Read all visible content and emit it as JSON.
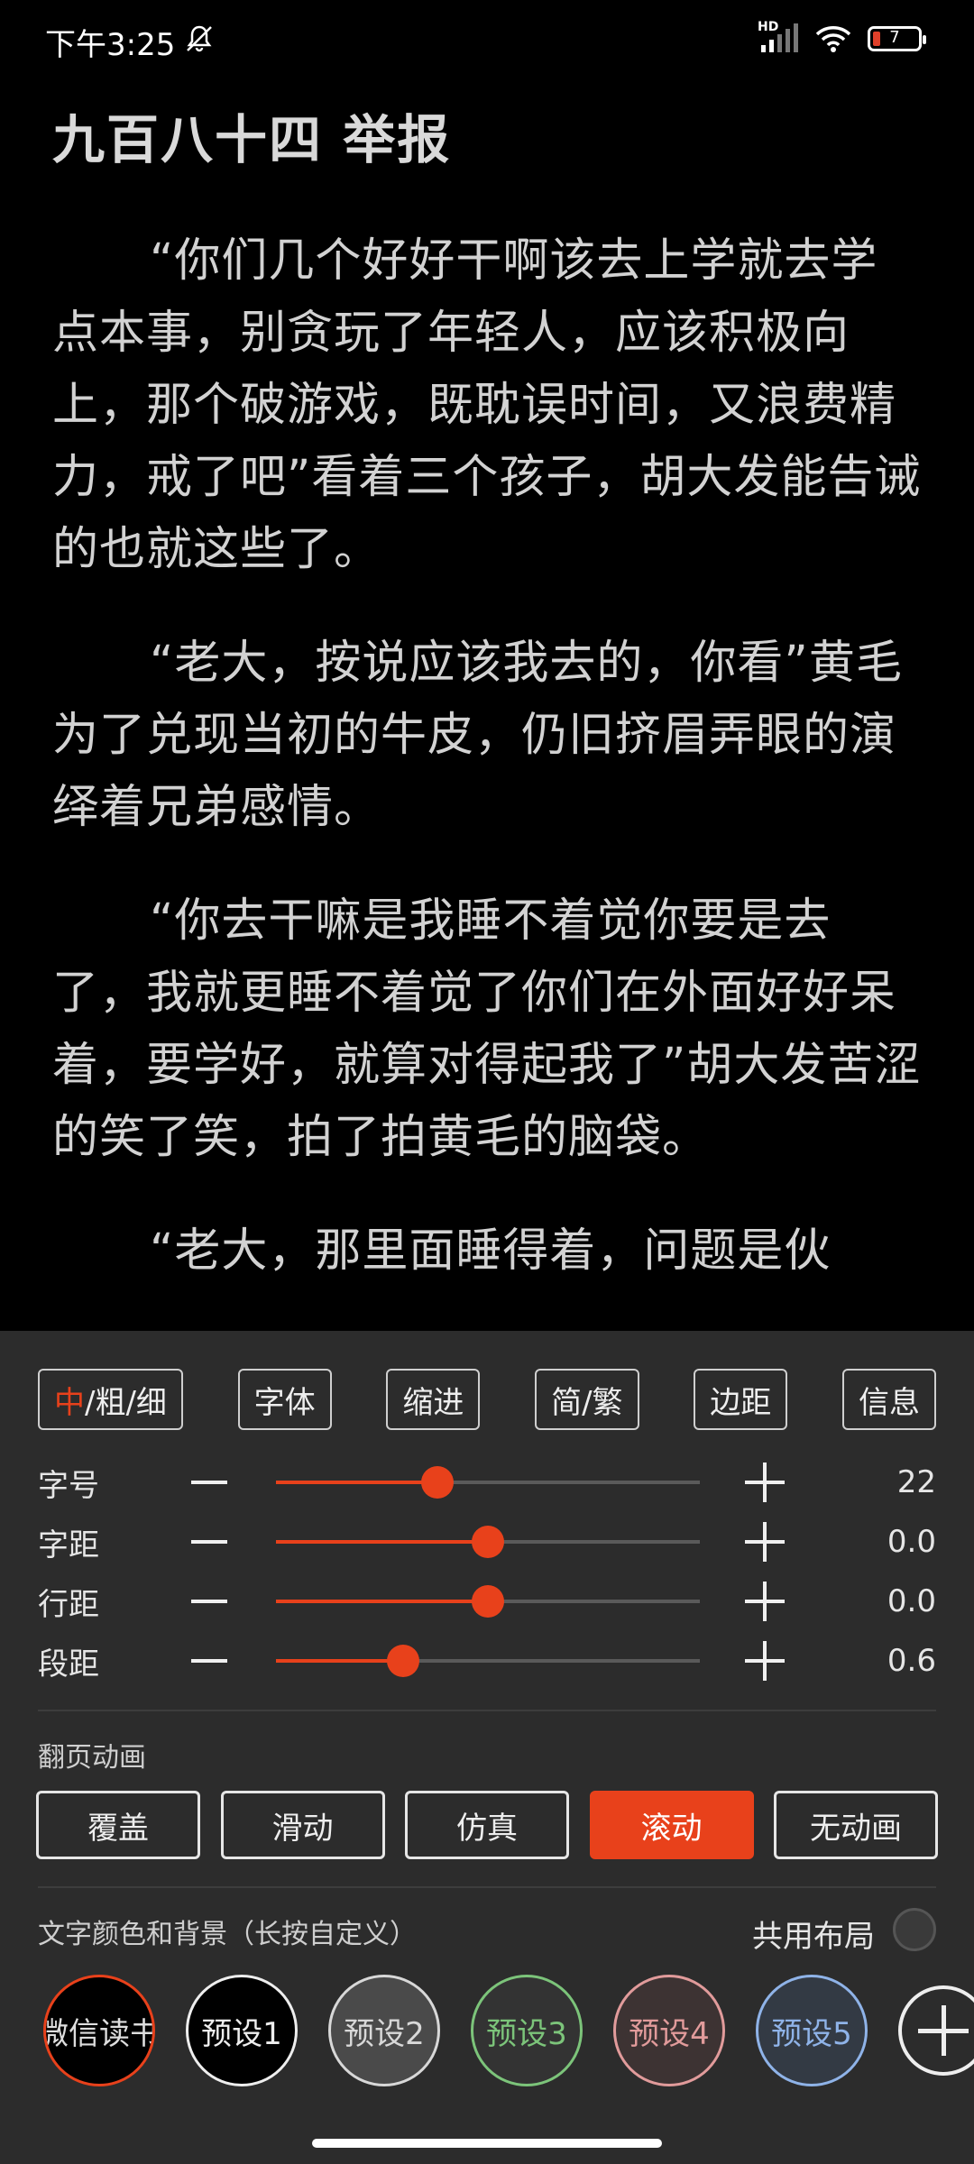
{
  "status_bar": {
    "time": "下午3:25",
    "hd": "HD",
    "battery_level": "7",
    "icons": [
      "mute-icon",
      "signal-icon",
      "wifi-icon",
      "battery-icon"
    ]
  },
  "reader": {
    "chapter_title": "九百八十四 举报",
    "paragraphs": [
      "“你们几个好好干啊该去上学就去学点本事，别贪玩了年轻人，应该积极向上，那个破游戏，既耽误时间，又浪费精力，戒了吧”看着三个孩子，胡大发能告诫的也就这些了。",
      "“老大，按说应该我去的，你看”黄毛为了兑现当初的牛皮，仍旧挤眉弄眼的演绎着兄弟感情。",
      "“你去干嘛是我睡不着觉你要是去了，我就更睡不着觉了你们在外面好好呆着，要学好，就算对得起我了”胡大发苦涩的笑了笑，拍了拍黄毛的脑袋。",
      "“老大，那里面睡得着，问题是伙"
    ]
  },
  "settings": {
    "style_buttons": {
      "weight_accent": "中",
      "weight_rest": "/粗/细",
      "font": "字体",
      "indent": "缩进",
      "script": "简/繁",
      "margin": "边距",
      "info": "信息"
    },
    "sliders": [
      {
        "label": "字号",
        "value": "22",
        "fraction": 0.38
      },
      {
        "label": "字距",
        "value": "0.0",
        "fraction": 0.5
      },
      {
        "label": "行距",
        "value": "0.0",
        "fraction": 0.5
      },
      {
        "label": "段距",
        "value": "0.6",
        "fraction": 0.3
      }
    ],
    "page_animation": {
      "label": "翻页动画",
      "options": [
        "覆盖",
        "滑动",
        "仿真",
        "滚动",
        "无动画"
      ],
      "selected": "滚动"
    },
    "theme": {
      "label": "文字颜色和背景（长按自定义）",
      "shared_layout_label": "共用布局",
      "presets": [
        "微信读书",
        "预设1",
        "预设2",
        "预设3",
        "预设4",
        "预设5"
      ]
    }
  },
  "colors": {
    "accent": "#e8411b",
    "panel_bg": "#2c2c2c",
    "page_bg": "#000000"
  }
}
